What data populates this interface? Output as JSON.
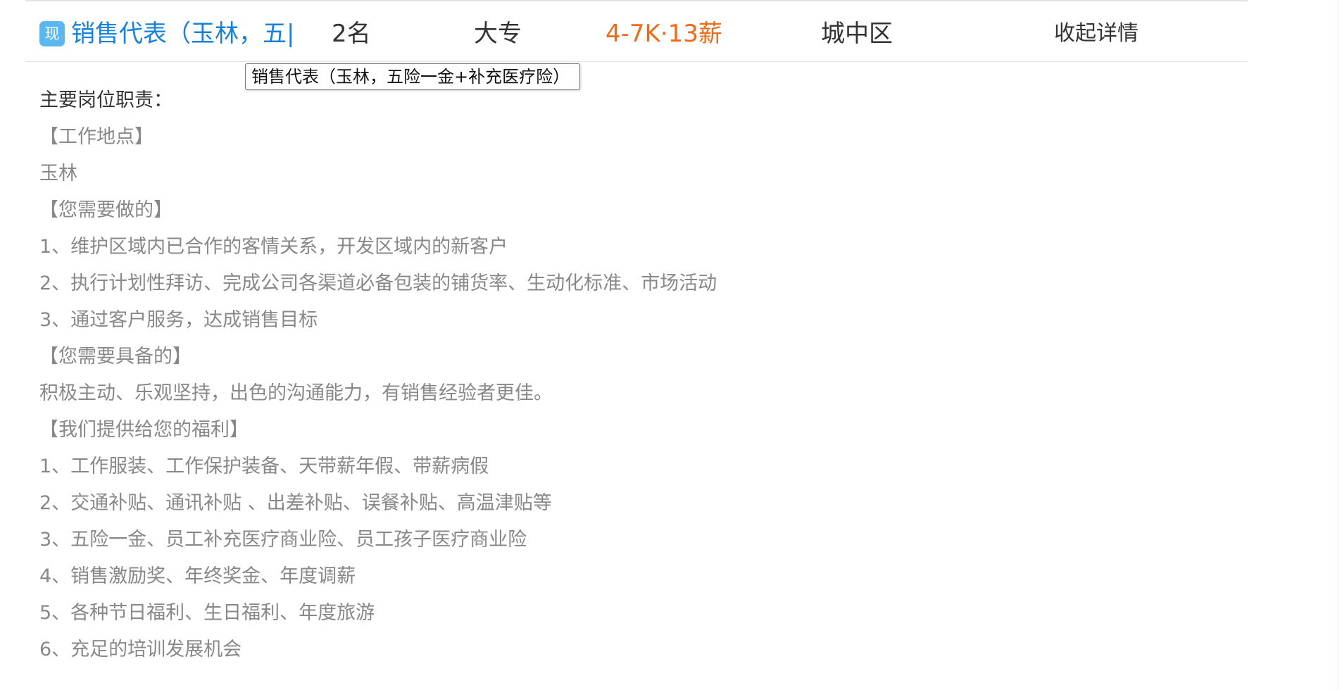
{
  "job": {
    "type_badge": "现",
    "title_truncated": "销售代表（玉林，五|",
    "count": "2名",
    "education": "大专",
    "salary": "4-7K·13薪",
    "district": "城中区",
    "toggle_details": "收起详情"
  },
  "tooltip": {
    "text": "销售代表（玉林，五险一金+补充医疗险）"
  },
  "details": {
    "heading": "主要岗位职责：",
    "lines": [
      "【工作地点】",
      "玉林",
      "【您需要做的】",
      "1、维护区域内已合作的客情关系，开发区域内的新客户",
      "2、执行计划性拜访、完成公司各渠道必备包装的铺货率、生动化标准、市场活动",
      "3、通过客户服务，达成销售目标",
      "【您需要具备的】",
      "积极主动、乐观坚持，出色的沟通能力，有销售经验者更佳。",
      "【我们提供给您的福利】",
      "1、工作服装、工作保护装备、天带薪年假、带薪病假",
      "2、交通补贴、通讯补贴 、出差补贴、误餐补贴、高温津贴等",
      "3、五险一金、员工补充医疗商业险、员工孩子医疗商业险",
      "4、销售激励奖、年终奖金、年度调薪",
      "5、各种节日福利、生日福利、年度旅游",
      "6、充足的培训发展机会"
    ]
  },
  "colors": {
    "link": "#1681db",
    "salary": "#ee6b1a",
    "badge": "#5bb7ee",
    "body_text": "#333333",
    "detail_text": "#888888",
    "divider": "#e3e3e3"
  }
}
